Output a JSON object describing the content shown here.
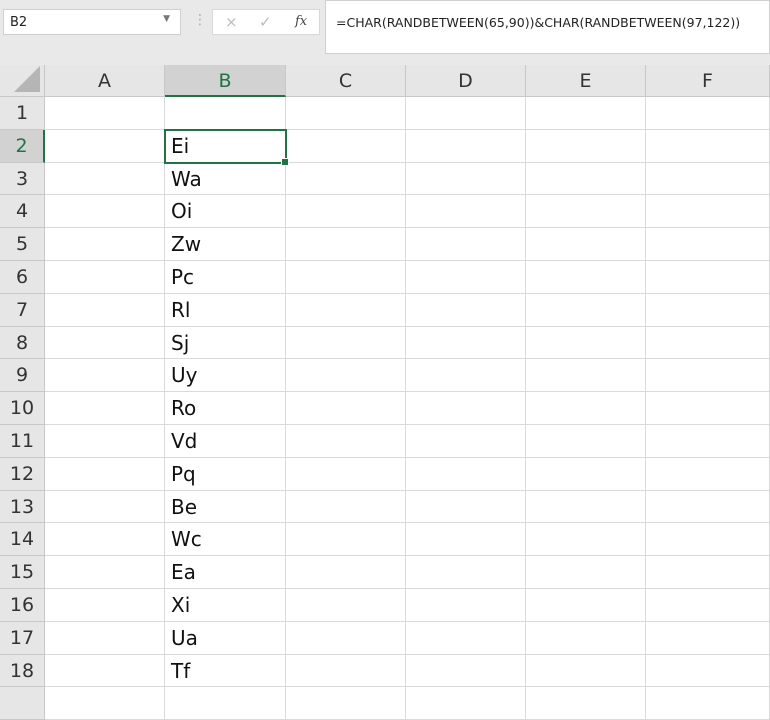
{
  "name_box": {
    "value": "B2"
  },
  "formula_bar": {
    "cancel_icon": "×",
    "enter_icon": "✓",
    "fx_label": "fx",
    "formula": "=CHAR(RANDBETWEEN(65,90))&CHAR(RANDBETWEEN(97,122))"
  },
  "columns": [
    "A",
    "B",
    "C",
    "D",
    "E",
    "F"
  ],
  "selected_cell": "B2",
  "rows": [
    {
      "num": "1",
      "b": ""
    },
    {
      "num": "2",
      "b": "Ei"
    },
    {
      "num": "3",
      "b": "Wa"
    },
    {
      "num": "4",
      "b": "Oi"
    },
    {
      "num": "5",
      "b": "Zw"
    },
    {
      "num": "6",
      "b": "Pc"
    },
    {
      "num": "7",
      "b": "Rl"
    },
    {
      "num": "8",
      "b": "Sj"
    },
    {
      "num": "9",
      "b": "Uy"
    },
    {
      "num": "10",
      "b": "Ro"
    },
    {
      "num": "11",
      "b": "Vd"
    },
    {
      "num": "12",
      "b": "Pq"
    },
    {
      "num": "13",
      "b": "Be"
    },
    {
      "num": "14",
      "b": "Wc"
    },
    {
      "num": "15",
      "b": "Ea"
    },
    {
      "num": "16",
      "b": "Xi"
    },
    {
      "num": "17",
      "b": "Ua"
    },
    {
      "num": "18",
      "b": "Tf"
    },
    {
      "num": "",
      "b": ""
    }
  ]
}
